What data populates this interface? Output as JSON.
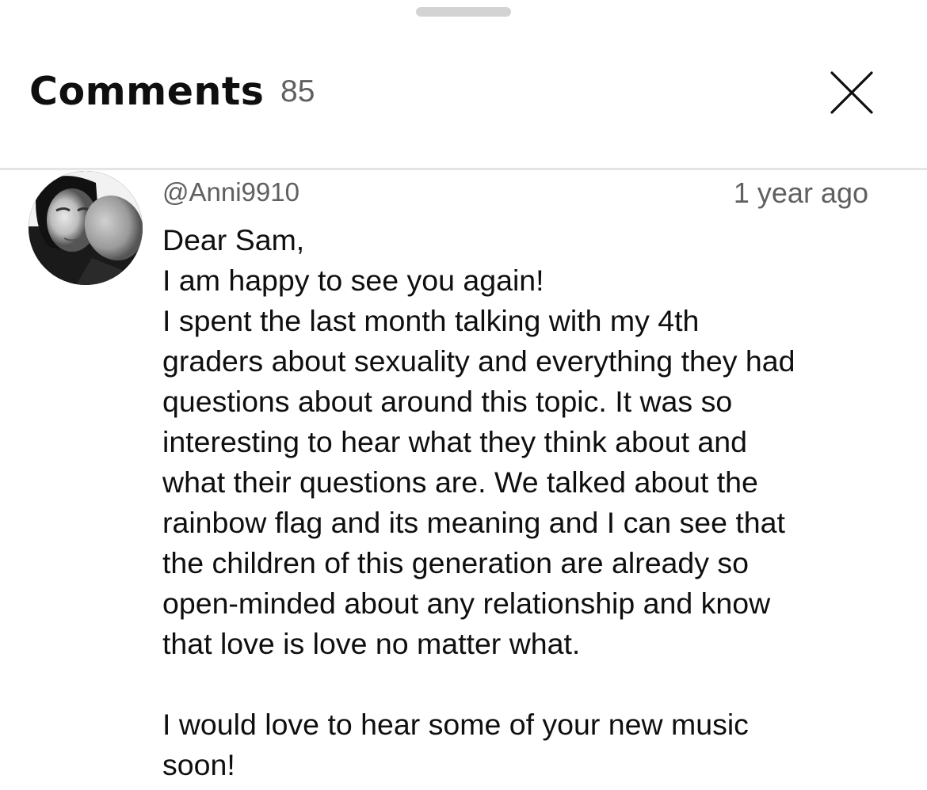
{
  "header": {
    "title": "Comments",
    "count": "85"
  },
  "comment": {
    "author": "@Anni9910",
    "timestamp": "1 year ago",
    "lines": [
      "Dear Sam,",
      "I am happy to see you again!",
      "I spent the last month talking with my 4th",
      "graders about sexuality and everything they had",
      "questions about around this topic. It was so",
      "interesting to hear what they think about and",
      "what their questions are. We talked about the",
      "rainbow flag and its meaning and I can see that",
      "the children of this generation are already so",
      "open-minded about any relationship and know",
      "that love is love no matter what.",
      "",
      "I would love to hear some of your new music",
      "soon!"
    ]
  },
  "icons": {
    "close": "close-icon",
    "avatar": "avatar"
  }
}
